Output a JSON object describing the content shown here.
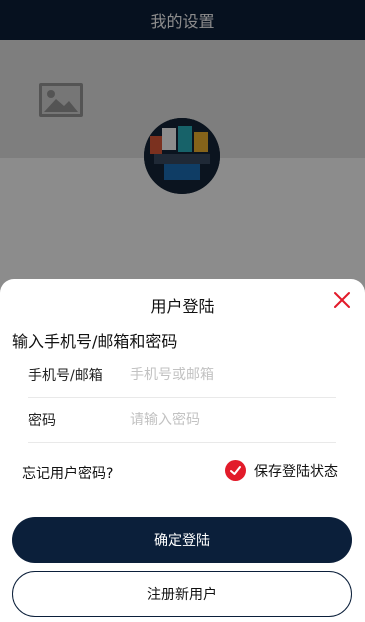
{
  "nav": {
    "title": "我的设置"
  },
  "login": {
    "title": "用户登陆",
    "subtitle": "输入手机号/邮箱和密码",
    "account": {
      "label": "手机号/邮箱",
      "placeholder": "手机号或邮箱",
      "value": ""
    },
    "password": {
      "label": "密码",
      "placeholder": "请输入密码",
      "value": ""
    },
    "forgot_label": "忘记用户密码?",
    "remember_label": "保存登陆状态",
    "remember_checked": true,
    "submit_label": "确定登陆",
    "register_label": "注册新用户"
  },
  "colors": {
    "primary": "#0b1f3a",
    "accent_red": "#e21b2a"
  }
}
